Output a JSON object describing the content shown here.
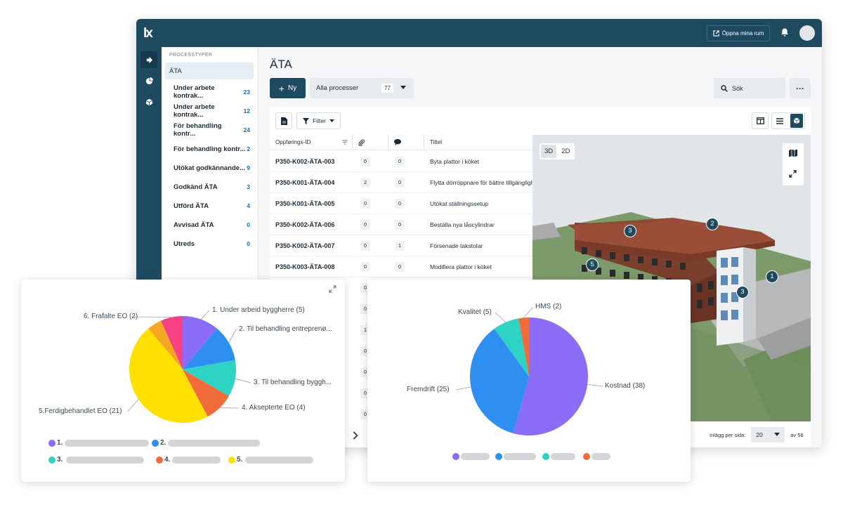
{
  "app": {
    "logo": "lx",
    "open_rooms_label": "Öppna mina rum",
    "page_title": "ÄTA",
    "new_button_label": "Ny",
    "process_select": {
      "value": "Alla processer",
      "count": "77"
    },
    "search_placeholder": "Sök",
    "more_label": "···",
    "filter_label": "Filter",
    "viewer": {
      "mode_3d": "3D",
      "mode_2d": "2D",
      "markers": [
        "3",
        "2",
        "5",
        "1",
        "3"
      ]
    },
    "pager": {
      "label": "Inlägg per sida:",
      "value": "20",
      "total": "av 56"
    }
  },
  "sidebar": {
    "heading": "PROCESSTYPER",
    "items": [
      {
        "label": "ÄTA",
        "count": ""
      },
      {
        "label": "Under arbete kontrak...",
        "count": "23"
      },
      {
        "label": "Under arbete kontrak...",
        "count": "12"
      },
      {
        "label": "För behandling kontr...",
        "count": "24"
      },
      {
        "label": "För behandling kontr...",
        "count": "2"
      },
      {
        "label": "Utökat godkännande...",
        "count": "9"
      },
      {
        "label": "Godkänd ÄTA",
        "count": "3"
      },
      {
        "label": "Utförd ÄTA",
        "count": "4"
      },
      {
        "label": "Avvisad ÄTA",
        "count": "0"
      },
      {
        "label": "Utreds",
        "count": "0"
      }
    ]
  },
  "table": {
    "headers": {
      "id": "Oppførings-ID",
      "title": "Tittel"
    },
    "rows": [
      {
        "id": "P350-K002-ÄTA-003",
        "attachments": "0",
        "comments": "0",
        "title": "Byta plattor i köket"
      },
      {
        "id": "P350-K001-ÄTA-004",
        "attachments": "2",
        "comments": "0",
        "title": "Flytta dörröppnare för bättre tillgänglighet"
      },
      {
        "id": "P350-K001-ÄTA-005",
        "attachments": "0",
        "comments": "0",
        "title": "Utökat ställningssetup"
      },
      {
        "id": "P350-K002-ÄTA-006",
        "attachments": "0",
        "comments": "0",
        "title": "Beställa nya låscylindrar"
      },
      {
        "id": "P350-K002-ÄTA-007",
        "attachments": "0",
        "comments": "1",
        "title": "Försenade takstolar"
      },
      {
        "id": "P350-K003-ÄTA-008",
        "attachments": "0",
        "comments": "0",
        "title": "Modifiera plattor i köket"
      }
    ],
    "hidden_row_attachments": [
      "0",
      "0",
      "1",
      "0",
      "0",
      "0",
      "0"
    ]
  },
  "colors": {
    "navy": "#1e4a60",
    "purple": "#8b6cf6",
    "blue": "#2f8ff0",
    "teal": "#2fd3c4",
    "orange": "#f26b3a",
    "yellow": "#ffe000",
    "amber": "#f5a623",
    "pink": "#f64283"
  },
  "chart_data": [
    {
      "type": "pie",
      "slices": [
        {
          "label": "1. Under arbeid byggherre (5)",
          "value": 5,
          "color": "#8b6cf6"
        },
        {
          "label": "2. Til behandling entreprenø...",
          "value": 5,
          "color": "#2f8ff0"
        },
        {
          "label": "3. Til behandling byggh...",
          "value": 5,
          "color": "#2fd3c4"
        },
        {
          "label": "4. Aksepterte EO (4)",
          "value": 4,
          "color": "#f26b3a"
        },
        {
          "label": "5.Ferdigbehandlet EO (21)",
          "value": 21,
          "color": "#ffe000"
        },
        {
          "label": "",
          "value": 2,
          "color": "#f5a623"
        },
        {
          "label": "6. Frafalte EO (2)",
          "value": 3,
          "color": "#f64283"
        }
      ],
      "legend": [
        "1.",
        "2.",
        "3.",
        "4.",
        "5."
      ]
    },
    {
      "type": "pie",
      "slices": [
        {
          "label": "Kostnad (38)",
          "value": 38,
          "color": "#8b6cf6"
        },
        {
          "label": "Fremdrift (25)",
          "value": 25,
          "color": "#2f8ff0"
        },
        {
          "label": "Kvalitet (5)",
          "value": 5,
          "color": "#2fd3c4"
        },
        {
          "label": "HMS (2)",
          "value": 2,
          "color": "#f26b3a"
        }
      ]
    }
  ]
}
